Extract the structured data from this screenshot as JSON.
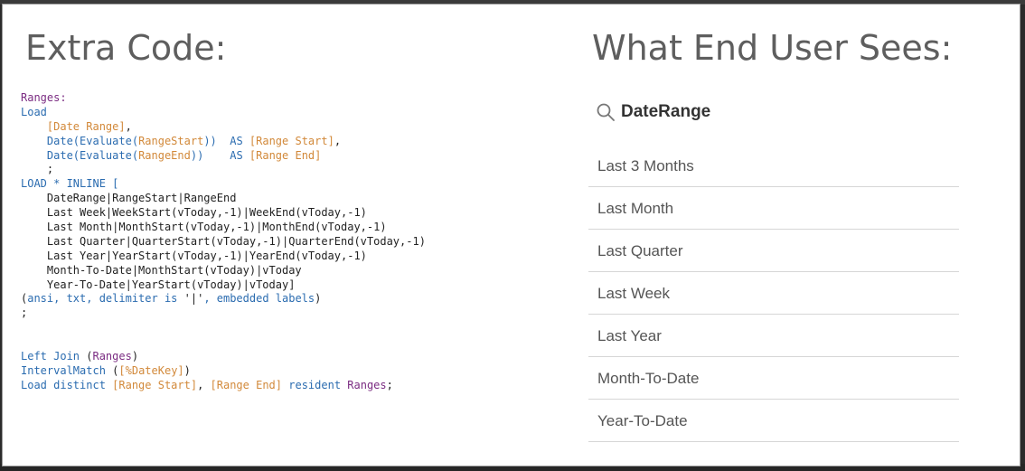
{
  "slide": {
    "left_heading": "Extra Code:",
    "right_heading": "What End User Sees:"
  },
  "code_lines": [
    [
      {
        "t": "Ranges:",
        "c": "purple"
      }
    ],
    [
      {
        "t": "Load",
        "c": "blue"
      }
    ],
    [
      {
        "t": "    "
      },
      {
        "t": "[Date Range]",
        "c": "orange"
      },
      {
        "t": ",",
        "c": "dark"
      }
    ],
    [
      {
        "t": "    "
      },
      {
        "t": "Date(Evaluate(",
        "c": "blue"
      },
      {
        "t": "RangeStart",
        "c": "orange"
      },
      {
        "t": "))  ",
        "c": "blue"
      },
      {
        "t": "AS ",
        "c": "blue"
      },
      {
        "t": "[Range Start]",
        "c": "orange"
      },
      {
        "t": ",",
        "c": "dark"
      }
    ],
    [
      {
        "t": "    "
      },
      {
        "t": "Date(Evaluate(",
        "c": "blue"
      },
      {
        "t": "RangeEnd",
        "c": "orange"
      },
      {
        "t": "))    ",
        "c": "blue"
      },
      {
        "t": "AS ",
        "c": "blue"
      },
      {
        "t": "[Range End]",
        "c": "orange"
      }
    ],
    [
      {
        "t": "    ;",
        "c": "dark"
      }
    ],
    [
      {
        "t": "LOAD * INLINE [",
        "c": "blue"
      }
    ],
    [
      {
        "t": "    DateRange|RangeStart|RangeEnd",
        "c": "dark"
      }
    ],
    [
      {
        "t": "    Last Week|WeekStart(vToday,-1)|WeekEnd(vToday,-1)",
        "c": "dark"
      }
    ],
    [
      {
        "t": "    Last Month|MonthStart(vToday,-1)|MonthEnd(vToday,-1)",
        "c": "dark"
      }
    ],
    [
      {
        "t": "    Last Quarter|QuarterStart(vToday,-1)|QuarterEnd(vToday,-1)",
        "c": "dark"
      }
    ],
    [
      {
        "t": "    Last Year|YearStart(vToday,-1)|YearEnd(vToday,-1)",
        "c": "dark"
      }
    ],
    [
      {
        "t": "    Month-To-Date|MonthStart(vToday)|vToday",
        "c": "dark"
      }
    ],
    [
      {
        "t": "    Year-To-Date|YearStart(vToday)|vToday]",
        "c": "dark"
      }
    ],
    [
      {
        "t": "(",
        "c": "dark"
      },
      {
        "t": "ansi, txt, delimiter is ",
        "c": "blue"
      },
      {
        "t": "'|'",
        "c": "dark"
      },
      {
        "t": ", embedded labels",
        "c": "blue"
      },
      {
        "t": ")",
        "c": "dark"
      }
    ],
    [
      {
        "t": ";",
        "c": "dark"
      }
    ],
    [
      {
        "t": ""
      }
    ],
    [
      {
        "t": ""
      }
    ],
    [
      {
        "t": "Left Join ",
        "c": "blue"
      },
      {
        "t": "(",
        "c": "dark"
      },
      {
        "t": "Ranges",
        "c": "purple"
      },
      {
        "t": ")",
        "c": "dark"
      }
    ],
    [
      {
        "t": "IntervalMatch ",
        "c": "blue"
      },
      {
        "t": "(",
        "c": "dark"
      },
      {
        "t": "[%DateKey]",
        "c": "orange"
      },
      {
        "t": ")",
        "c": "dark"
      }
    ],
    [
      {
        "t": "Load distinct ",
        "c": "blue"
      },
      {
        "t": "[Range Start]",
        "c": "orange"
      },
      {
        "t": ", ",
        "c": "dark"
      },
      {
        "t": "[Range End]",
        "c": "orange"
      },
      {
        "t": " resident ",
        "c": "blue"
      },
      {
        "t": "Ranges",
        "c": "purple"
      },
      {
        "t": ";",
        "c": "dark"
      }
    ]
  ],
  "filter": {
    "search_label": "DateRange",
    "search_icon": "search-icon",
    "items": [
      {
        "label": "Last 3 Months"
      },
      {
        "label": "Last Month"
      },
      {
        "label": "Last Quarter"
      },
      {
        "label": "Last Week"
      },
      {
        "label": "Last Year"
      },
      {
        "label": "Month-To-Date"
      },
      {
        "label": "Year-To-Date"
      }
    ]
  },
  "colors": {
    "purple": "#7b2c82",
    "blue": "#2b6cb0",
    "orange": "#d2893a",
    "dark": "#222222"
  }
}
